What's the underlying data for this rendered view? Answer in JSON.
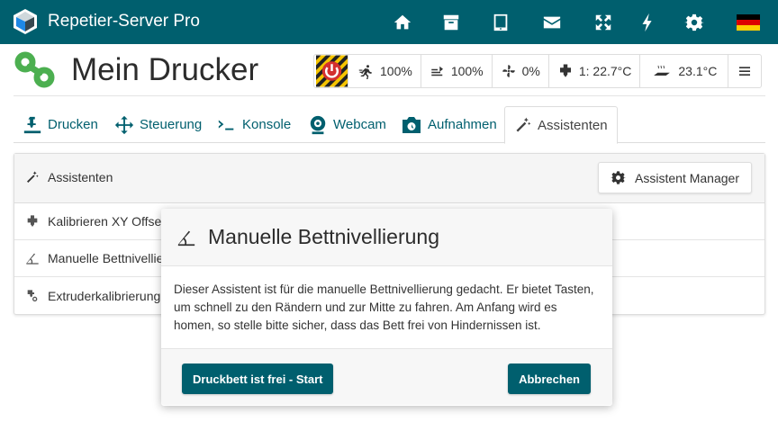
{
  "app": {
    "title": "Repetier-Server Pro"
  },
  "topnav": [
    {
      "name": "home-icon"
    },
    {
      "name": "archive-icon"
    },
    {
      "name": "tablet-icon"
    },
    {
      "name": "envelope-icon"
    },
    {
      "name": "fullscreen-icon"
    },
    {
      "name": "bolt-icon"
    },
    {
      "name": "gear-icon"
    },
    {
      "name": "german-flag-icon"
    }
  ],
  "printer": {
    "name": "Mein Drucker"
  },
  "status": {
    "speed": "100%",
    "flow": "100%",
    "fan": "0%",
    "extruder": "1: 22.7°C",
    "bed": "23.1°C"
  },
  "tabs": [
    {
      "label": "Drucken",
      "icon": "print-icon"
    },
    {
      "label": "Steuerung",
      "icon": "move-icon"
    },
    {
      "label": "Konsole",
      "icon": "terminal-icon"
    },
    {
      "label": "Webcam",
      "icon": "webcam-icon"
    },
    {
      "label": "Aufnahmen",
      "icon": "camera-icon"
    },
    {
      "label": "Assistenten",
      "icon": "magic-wand-icon",
      "active": true
    }
  ],
  "panel": {
    "title": "Assistenten",
    "manager_button": "Assistent Manager",
    "items": [
      {
        "label": "Kalibrieren XY Offset"
      },
      {
        "label": "Manuelle Bettnivellierung"
      },
      {
        "label": "Extruderkalibrierung"
      }
    ]
  },
  "modal": {
    "title": "Manuelle Bettnivellierung",
    "body": "Dieser Assistent ist für die manuelle Bettnivellierung gedacht. Er bietet Tasten, um schnell zu den Rändern und zur Mitte zu fahren. Am Anfang wird es homen, so stelle bitte sicher, dass das Bett frei von Hindernissen ist.",
    "start_button": "Druckbett ist frei - Start",
    "cancel_button": "Abbrechen"
  },
  "colors": {
    "primary": "#005f6e",
    "logo_green": "#4caf50"
  }
}
